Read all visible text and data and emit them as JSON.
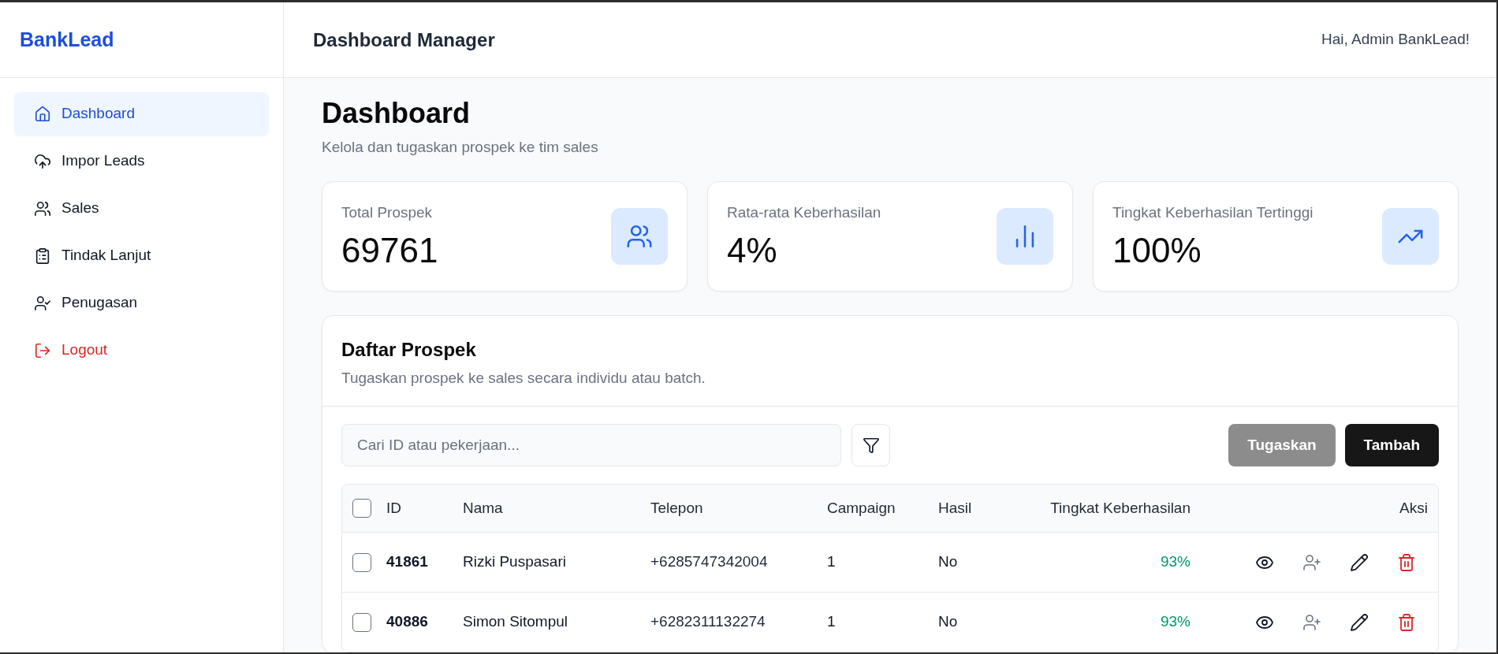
{
  "app": {
    "logo": "BankLead"
  },
  "sidebar": {
    "items": [
      {
        "label": "Dashboard",
        "selected": true,
        "kind": "link"
      },
      {
        "label": "Impor Leads",
        "selected": false,
        "kind": "link"
      },
      {
        "label": "Sales",
        "selected": false,
        "kind": "link"
      },
      {
        "label": "Tindak Lanjut",
        "selected": false,
        "kind": "link"
      },
      {
        "label": "Penugasan",
        "selected": false,
        "kind": "link"
      },
      {
        "label": "Logout",
        "selected": false,
        "kind": "logout"
      }
    ]
  },
  "header": {
    "title": "Dashboard Manager",
    "greeting": "Hai, Admin BankLead!"
  },
  "page": {
    "title": "Dashboard",
    "subtitle": "Kelola dan tugaskan prospek ke tim sales"
  },
  "stats": [
    {
      "label": "Total Prospek",
      "value": "69761"
    },
    {
      "label": "Rata-rata Keberhasilan",
      "value": "4%"
    },
    {
      "label": "Tingkat Keberhasilan Tertinggi",
      "value": "100%"
    }
  ],
  "prospects": {
    "title": "Daftar Prospek",
    "subtitle": "Tugaskan prospek ke sales secara individu atau batch.",
    "search": {
      "placeholder": "Cari ID atau pekerjaan..."
    },
    "buttons": [
      {
        "label": "Tugaskan",
        "disabled": true
      },
      {
        "label": "Tambah",
        "disabled": false
      }
    ],
    "table": {
      "select_all": {
        "checked": false
      },
      "columns": [
        "ID",
        "Nama",
        "Telepon",
        "Campaign",
        "Hasil",
        "Tingkat Keberhasilan",
        "Aksi"
      ],
      "rows": [
        {
          "checked": false,
          "id": "41861",
          "name": "Rizki Puspasari",
          "phone": "+6285747342004",
          "campaign": "1",
          "result": "No",
          "success_rate": "93%"
        },
        {
          "checked": false,
          "id": "40886",
          "name": "Simon Sitompul",
          "phone": "+6282311132274",
          "campaign": "1",
          "result": "No",
          "success_rate": "93%"
        }
      ]
    }
  }
}
